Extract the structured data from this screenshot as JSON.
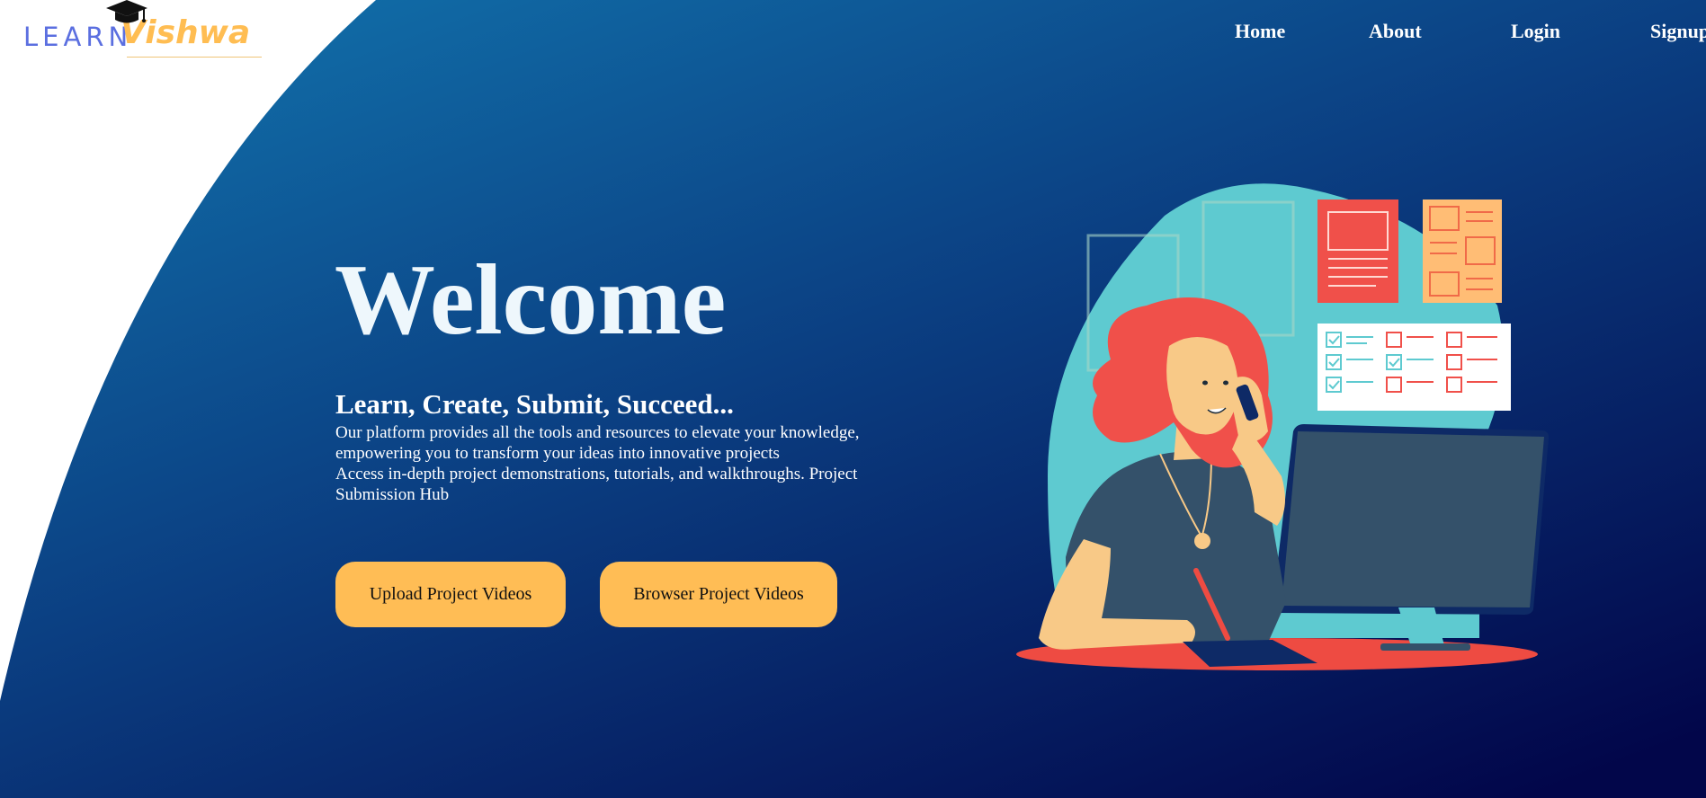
{
  "logo": {
    "learn": "LEARN",
    "vishwa": "Vishwa",
    "icon": "graduation-cap-icon"
  },
  "nav": {
    "home": "Home",
    "about": "About",
    "login": "Login",
    "signup": "Signup"
  },
  "hero": {
    "title": "Welcome",
    "tagline": "Learn, Create, Submit, Succeed...",
    "description_line1": "Our platform provides all the tools and resources to elevate your knowledge, empowering you to transform your ideas into innovative projects",
    "description_line2": "Access in-depth project demonstrations, tutorials, and walkthroughs. Project Submission Hub",
    "upload_button": "Upload Project Videos",
    "browse_button": "Browser Project Videos"
  },
  "colors": {
    "bg_gradient_start": "#0f6aa4",
    "bg_gradient_end": "#020c4e",
    "accent": "#ffbd55",
    "logo_blue": "#5b6fe0",
    "logo_orange": "#ffbd52"
  }
}
